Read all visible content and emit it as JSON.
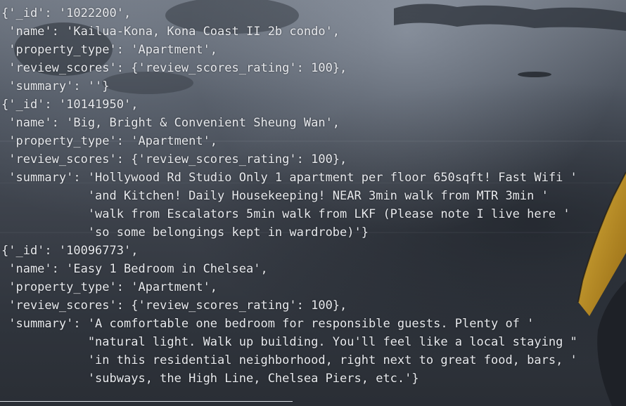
{
  "terminal": {
    "lines": [
      "{'_id': '1022200',",
      " 'name': 'Kailua-Kona, Kona Coast II 2b condo',",
      " 'property_type': 'Apartment',",
      " 'review_scores': {'review_scores_rating': 100},",
      " 'summary': ''}",
      "{'_id': '10141950',",
      " 'name': 'Big, Bright & Convenient Sheung Wan',",
      " 'property_type': 'Apartment',",
      " 'review_scores': {'review_scores_rating': 100},",
      " 'summary': 'Hollywood Rd Studio Only 1 apartment per floor 650sqft! Fast Wifi '",
      "            'and Kitchen! Daily Housekeeping! NEAR 3min walk from MTR 3min '",
      "            'walk from Escalators 5min walk from LKF (Please note I live here '",
      "            'so some belongings kept in wardrobe)'}",
      "{'_id': '10096773',",
      " 'name': 'Easy 1 Bedroom in Chelsea',",
      " 'property_type': 'Apartment',",
      " 'review_scores': {'review_scores_rating': 100},",
      " 'summary': 'A comfortable one bedroom for responsible guests. Plenty of '",
      "            \"natural light. Walk up building. You'll feel like a local staying \"",
      "            'in this residential neighborhood, right next to great food, bars, '",
      "            'subways, the High Line, Chelsea Piers, etc.'}"
    ]
  }
}
